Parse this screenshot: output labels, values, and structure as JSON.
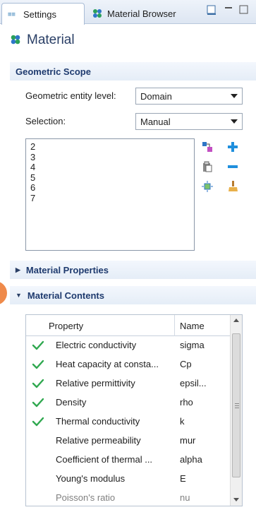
{
  "tabs": {
    "settings": "Settings",
    "material_browser": "Material Browser"
  },
  "header": {
    "title": "Material"
  },
  "geometric_scope": {
    "header": "Geometric Scope",
    "entity_level_label": "Geometric entity level:",
    "entity_level_value": "Domain",
    "selection_label": "Selection:",
    "selection_value": "Manual",
    "items": [
      "2",
      "3",
      "4",
      "5",
      "6",
      "7"
    ]
  },
  "material_properties": {
    "header": "Material Properties"
  },
  "material_contents": {
    "header": "Material Contents",
    "columns": {
      "property": "Property",
      "name": "Name"
    },
    "rows": [
      {
        "checked": true,
        "property": "Electric conductivity",
        "name": "sigma"
      },
      {
        "checked": true,
        "property": "Heat capacity at consta...",
        "name": "Cp"
      },
      {
        "checked": true,
        "property": "Relative permittivity",
        "name": "epsil..."
      },
      {
        "checked": true,
        "property": "Density",
        "name": "rho"
      },
      {
        "checked": true,
        "property": "Thermal conductivity",
        "name": "k"
      },
      {
        "checked": false,
        "property": "Relative permeability",
        "name": "mur"
      },
      {
        "checked": false,
        "property": "Coefficient of thermal ...",
        "name": "alpha"
      },
      {
        "checked": false,
        "property": "Young's modulus",
        "name": "E"
      },
      {
        "checked": false,
        "property": "Poisson's ratio",
        "name": "nu"
      }
    ]
  },
  "colors": {
    "accent": "#1e3a6e",
    "check": "#2fa84f",
    "add": "#1f8fdd",
    "highlight": "#ef8a4a"
  }
}
